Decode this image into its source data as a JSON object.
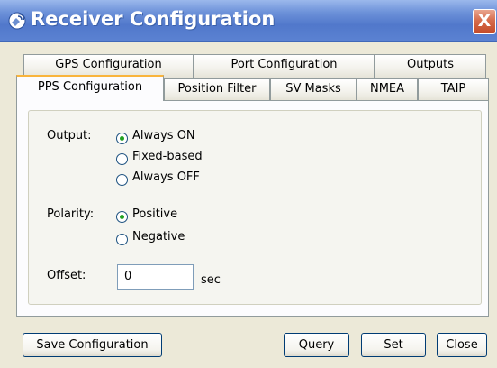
{
  "window": {
    "title": "Receiver Configuration",
    "close_symbol": "X"
  },
  "tabs": {
    "back_row": [
      "GPS Configuration",
      "Port Configuration",
      "Outputs"
    ],
    "front_row": [
      "PPS Configuration",
      "Position Filter",
      "SV Masks",
      "NMEA",
      "TAIP"
    ],
    "selected": "PPS Configuration"
  },
  "pps": {
    "output_label": "Output:",
    "output_options": [
      "Always ON",
      "Fixed-based",
      "Always OFF"
    ],
    "output_selected": "Always ON",
    "polarity_label": "Polarity:",
    "polarity_options": [
      "Positive",
      "Negative"
    ],
    "polarity_selected": "Positive",
    "offset_label": "Offset:",
    "offset_value": "0",
    "offset_unit": "sec"
  },
  "buttons": {
    "save": "Save Configuration",
    "query": "Query",
    "set": "Set",
    "close": "Close"
  },
  "colors": {
    "accent_tab": "#f9b43c",
    "titlebar": "#5178cb",
    "radio_dot": "#21a121"
  }
}
